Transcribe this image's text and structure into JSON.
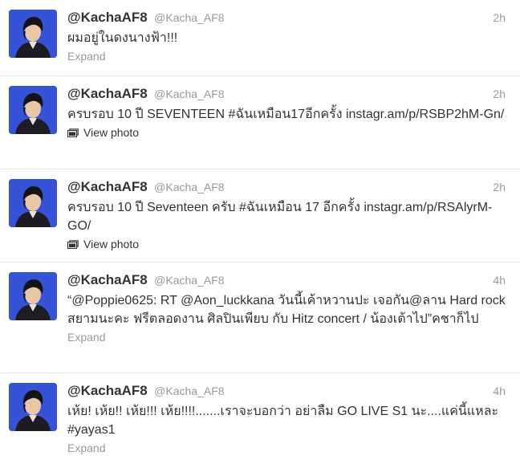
{
  "tweets": [
    {
      "fullname": "@KachaAF8",
      "username": "@Kacha_AF8",
      "time": "2h",
      "text": "ผมอยู่ในดงนางฟ้า!!!",
      "action": "Expand",
      "action_type": "expand"
    },
    {
      "fullname": "@KachaAF8",
      "username": "@Kacha_AF8",
      "time": "2h",
      "text": "ครบรอบ 10 ปี SEVENTEEN #ฉันเหมือน17อีกครั้ง instagr.am/p/RSBP2hM-Gn/",
      "action": "View photo",
      "action_type": "photo"
    },
    {
      "fullname": "@KachaAF8",
      "username": "@Kacha_AF8",
      "time": "2h",
      "text": "ครบรอบ 10 ปี Seventeen ครับ #ฉันเหมือน 17 อีกครั้ง instagr.am/p/RSAlyrM-GO/",
      "action": "View photo",
      "action_type": "photo"
    },
    {
      "fullname": "@KachaAF8",
      "username": "@Kacha_AF8",
      "time": "4h",
      "text": "“@Poppie0625: RT @Aon_luckkana วันนี้เค้าหวานปะ เจอกัน@ลาน Hard rock สยามนะคะ ฟรีตลอดงาน ศิลปินเพียบ กับ Hitz concert / น้องเต้าไป”คชาก็ไป",
      "action": "Expand",
      "action_type": "expand"
    },
    {
      "fullname": "@KachaAF8",
      "username": "@Kacha_AF8",
      "time": "4h",
      "text": "เห้ย! เห้ย!! เห้ย!!! เห้ย!!!!.......เราจะบอกว่า อย่าลืม GO LIVE S1 นะ....แค่นี้แหละ #yayas1",
      "action": "Expand",
      "action_type": "expand"
    }
  ],
  "icons": {
    "avatar": "profile-photo",
    "photo": "photo-icon"
  },
  "colors": {
    "name": "#333333",
    "meta": "#999999",
    "avatar_bg": "#3553d6",
    "divider": "#e8e8e8"
  }
}
